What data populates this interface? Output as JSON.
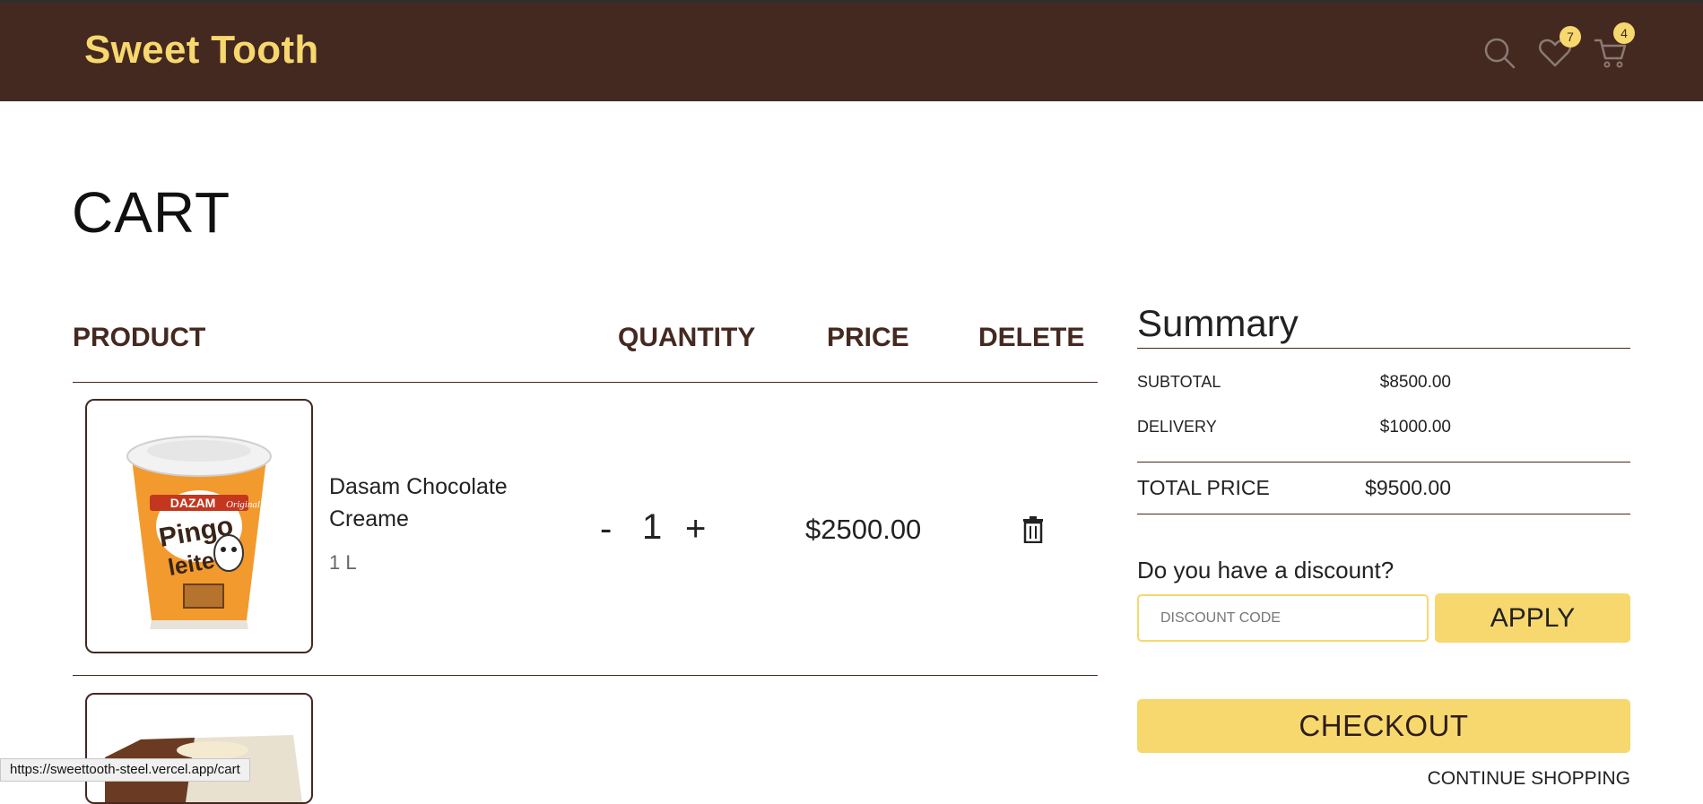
{
  "header": {
    "brand": "Sweet Tooth",
    "icons": [
      "search-icon",
      "heart-icon",
      "cart-icon"
    ],
    "wishlist_count": "7",
    "cart_count": "4"
  },
  "page": {
    "title": "CART"
  },
  "table": {
    "columns": [
      "PRODUCT",
      "QUANTITY",
      "PRICE",
      "DELETE"
    ],
    "items": [
      {
        "name": "Dasam Chocolate Creame",
        "variant": "1 L",
        "quantity": "1",
        "minus": "-",
        "plus": "+",
        "price": "$2500.00",
        "image_text": [
          "DAZAM",
          "Original",
          "Pingo",
          "leite"
        ]
      }
    ]
  },
  "summary": {
    "title": "Summary",
    "subtotal_label": "SUBTOTAL",
    "subtotal_value": "$8500.00",
    "delivery_label": "DELIVERY",
    "delivery_value": "$1000.00",
    "total_label": "TOTAL PRICE",
    "total_value": "$9500.00",
    "discount_question": "Do you have a discount?",
    "discount_placeholder": "DISCOUNT CODE",
    "apply_label": "APPLY",
    "checkout_label": "CHECKOUT",
    "continue_label": "CONTINUE SHOPPING"
  },
  "status_bar": {
    "url": "https://sweettooth-steel.vercel.app/cart"
  },
  "colors": {
    "header_bg": "#442921",
    "accent": "#f7d86e",
    "text_dark": "#222222"
  }
}
